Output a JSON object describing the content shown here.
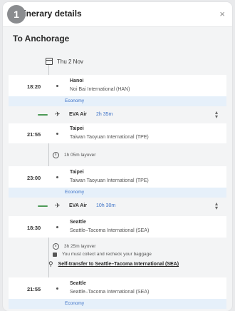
{
  "header": {
    "step_number": "1",
    "title": "Itinerary details",
    "close_label": "×"
  },
  "destination": "To Anchorage",
  "date": "Thu 2 Nov",
  "segments": [
    {
      "dep_time": "18:20",
      "dep_city": "Hanoi",
      "dep_airport": "Noi Bai International (HAN)",
      "cabin": "Economy",
      "airline": "EVA Air",
      "duration": "2h 35m",
      "arr_time": "21:55",
      "arr_city": "Taipei",
      "arr_airport": "Taiwan Taoyuan International (TPE)"
    },
    {
      "dep_time": "23:00",
      "dep_city": "Taipei",
      "dep_airport": "Taiwan Taoyuan International (TPE)",
      "cabin": "Economy",
      "airline": "EVA Air",
      "duration": "10h 30m",
      "arr_time": "18:30",
      "arr_city": "Seattle",
      "arr_airport": "Seattle–Tacoma International (SEA)"
    },
    {
      "dep_time": "21:55",
      "dep_city": "Seattle",
      "dep_airport": "Seattle–Tacoma International (SEA)",
      "cabin": "Economy"
    }
  ],
  "layover1": "1h 05m layover",
  "layover2": "3h 25m layover",
  "baggage_note": "You must collect and recheck your baggage",
  "self_transfer": "Self-transfer to Seattle–Tacoma International (SEA)",
  "colors": {
    "accent": "#3d72c7",
    "economy_bg": "#e6f0fa",
    "logo": "#4d9a57"
  }
}
